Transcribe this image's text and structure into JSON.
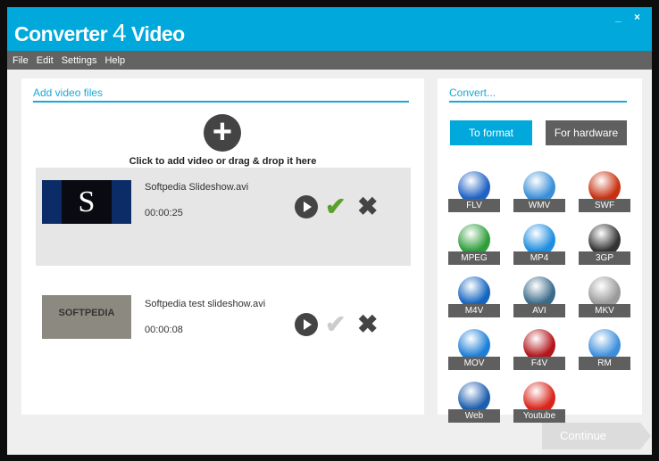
{
  "window": {
    "title_a": "Converter",
    "title_b": "4",
    "title_c": "Video",
    "minimize": "_",
    "close": "×"
  },
  "menu": [
    "File",
    "Edit",
    "Settings",
    "Help"
  ],
  "left": {
    "heading": "Add video files",
    "add_hint": "Click to add video or drag & drop it here",
    "files": [
      {
        "name": "Softpedia Slideshow.avi",
        "duration": "00:00:25",
        "thumb_text": "S"
      },
      {
        "name": "Softpedia test slideshow.avi",
        "duration": "00:00:08",
        "thumb_text": "SOFTPEDIA"
      }
    ]
  },
  "right": {
    "heading": "Convert...",
    "to_format": "To format",
    "for_hardware": "For hardware",
    "formats": [
      {
        "label": "FLV",
        "color": "#1f62c4"
      },
      {
        "label": "WMV",
        "color": "#3a8fd8"
      },
      {
        "label": "SWF",
        "color": "#c8300f"
      },
      {
        "label": "MPEG",
        "color": "#2e9e3b"
      },
      {
        "label": "MP4",
        "color": "#1f8ee0"
      },
      {
        "label": "3GP",
        "color": "#333333"
      },
      {
        "label": "M4V",
        "color": "#1565c0"
      },
      {
        "label": "AVI",
        "color": "#3b6b8a"
      },
      {
        "label": "MKV",
        "color": "#9a9a9a"
      },
      {
        "label": "MOV",
        "color": "#1e7fd8"
      },
      {
        "label": "F4V",
        "color": "#b3161b"
      },
      {
        "label": "RM",
        "color": "#3d8fdc"
      },
      {
        "label": "Web",
        "color": "#1d5fae"
      },
      {
        "label": "Youtube",
        "color": "#d9261c"
      }
    ]
  },
  "continue": "Continue",
  "colors": {
    "accent": "#00a8db",
    "menu": "#636363"
  }
}
